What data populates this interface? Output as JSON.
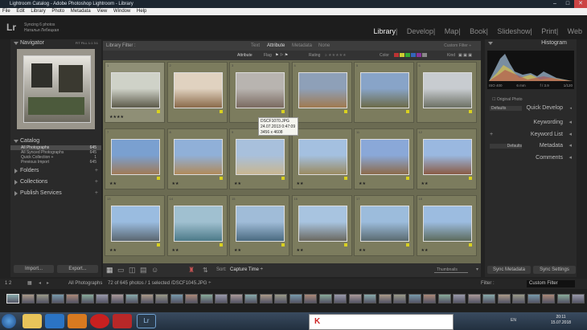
{
  "window": {
    "title": "Lightroom Catalog - Adobe Photoshop Lightroom - Library"
  },
  "menu": [
    "File",
    "Edit",
    "Library",
    "Photo",
    "Metadata",
    "View",
    "Window",
    "Help"
  ],
  "identity": {
    "logo": "Lr",
    "sync_line1": "Syncing 6 photos",
    "sync_line2": "Наталья Лебецкая"
  },
  "modules": [
    "Library",
    "Develop",
    "Map",
    "Book",
    "Slideshow",
    "Print",
    "Web"
  ],
  "left": {
    "navigator": {
      "title": "Navigator",
      "zoom": [
        "FIT",
        "FILL",
        "1:1",
        "3:1"
      ]
    },
    "catalog": {
      "title": "Catalog",
      "rows": [
        {
          "label": "All Photographs",
          "count": "645"
        },
        {
          "label": "All Synced Photographs",
          "count": "645"
        },
        {
          "label": "Quick Collection +",
          "count": "1"
        },
        {
          "label": "Previous Import",
          "count": "645"
        }
      ]
    },
    "folders": "Folders",
    "collections": "Collections",
    "publish": "Publish Services",
    "import": "Import...",
    "export": "Export..."
  },
  "filter": {
    "title": "Library Filter :",
    "tabs": [
      "Text",
      "Attribute",
      "Metadata",
      "None"
    ],
    "preset": "Custom Filter ÷",
    "attribute_label": "Attribute",
    "flag": "Flag",
    "rating": "Rating",
    "color": "Color",
    "kind": "Kind"
  },
  "tooltip": {
    "name": "DSCF1070.JPG",
    "date": "24.07.2013 0:47:09",
    "size": "3456 x 4608"
  },
  "cells": [
    {
      "n": "1",
      "stars": "★★★★"
    },
    {
      "n": "2",
      "stars": ""
    },
    {
      "n": "3",
      "stars": ""
    },
    {
      "n": "4",
      "stars": ""
    },
    {
      "n": "5",
      "stars": ""
    },
    {
      "n": "6",
      "stars": ""
    },
    {
      "n": "7",
      "stars": "★★"
    },
    {
      "n": "8",
      "stars": "★★"
    },
    {
      "n": "9",
      "stars": "★★"
    },
    {
      "n": "10",
      "stars": "★★"
    },
    {
      "n": "11",
      "stars": "★★"
    },
    {
      "n": "12",
      "stars": "★★"
    },
    {
      "n": "13",
      "stars": "★★"
    },
    {
      "n": "14",
      "stars": "★★"
    },
    {
      "n": "15",
      "stars": "★★"
    },
    {
      "n": "16",
      "stars": "★★"
    },
    {
      "n": "17",
      "stars": "★★"
    },
    {
      "n": "18",
      "stars": "★★"
    }
  ],
  "toolbar": {
    "sort_label": "Sort:",
    "sort_value": "Capture Time ÷",
    "thumbnails": "Thumbnails"
  },
  "right": {
    "histogram": "Histogram",
    "exif": {
      "iso": "ISO 400",
      "lens": "6 mm",
      "aperture": "f / 3.9",
      "shutter": "1/120"
    },
    "original": "Original Photo",
    "defaults": "Defaults",
    "quick_develop": "Quick Develop",
    "keywording": "Keywording",
    "keyword_list": "Keyword List",
    "metadata": "Metadata",
    "comments": "Comments",
    "sync_metadata": "Sync Metadata",
    "sync_settings": "Sync Settings"
  },
  "filmbar": {
    "pages": "1 2",
    "source": "All Photographs",
    "status": "72 of 645 photos / 1 selected /DSCF1045.JPG ÷",
    "filter_label": "Filter :",
    "filter_value": "Custom Filter"
  },
  "taskbar": {
    "lang": "EN",
    "time": "20:11",
    "date": "15.07.2018"
  },
  "colors": {
    "grid_bg": "#6b6b52",
    "cell_bg": "#7c7c5e",
    "panel_bg": "#2a2a2a",
    "accent_flag": "#d8d020"
  }
}
